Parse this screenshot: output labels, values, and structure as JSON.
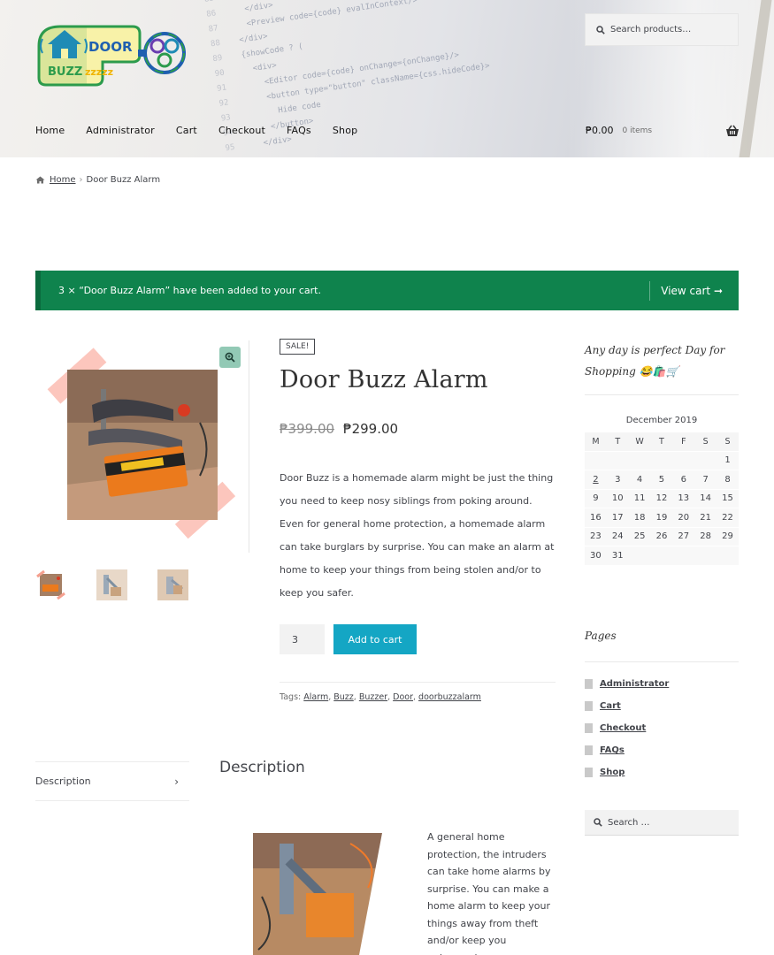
{
  "logo": {
    "line1": "DOOR",
    "line2": "BUZZzzzzz"
  },
  "search": {
    "placeholder": "Search products…"
  },
  "nav": [
    "Home",
    "Administrator",
    "Cart",
    "Checkout",
    "FAQs",
    "Shop"
  ],
  "cart": {
    "total": "₱0.00",
    "items": "0 items"
  },
  "breadcrumb": {
    "home": "Home",
    "current": "Door Buzz Alarm"
  },
  "notice": {
    "message": "3 × “Door Buzz Alarm” have been added to your cart.",
    "view_cart": "View cart ➞"
  },
  "product": {
    "badge": "SALE!",
    "title": "Door Buzz Alarm",
    "price_old": "₱399.00",
    "price_new": "₱299.00",
    "description": "Door Buzz is a homemade alarm might be just the thing you need to keep nosy siblings from poking around. Even for general home protection, a homemade alarm can take burglars by surprise. You can make an alarm at home to keep your things from being stolen and/or to keep you safer.",
    "quantity": "3",
    "add_to_cart": "Add to cart",
    "tags_label": "Tags:",
    "tags": [
      "Alarm",
      "Buzz",
      "Buzzer",
      "Door",
      "doorbuzzalarm"
    ]
  },
  "sidebar": {
    "tagline": "Any day is perfect Day for Shopping 😂🛍️🛒",
    "calendar": {
      "caption": "December 2019",
      "days": [
        "M",
        "T",
        "W",
        "T",
        "F",
        "S",
        "S"
      ],
      "weeks": [
        [
          "",
          "",
          "",
          "",
          "",
          "",
          "1"
        ],
        [
          "2",
          "3",
          "4",
          "5",
          "6",
          "7",
          "8"
        ],
        [
          "9",
          "10",
          "11",
          "12",
          "13",
          "14",
          "15"
        ],
        [
          "16",
          "17",
          "18",
          "19",
          "20",
          "21",
          "22"
        ],
        [
          "23",
          "24",
          "25",
          "26",
          "27",
          "28",
          "29"
        ],
        [
          "30",
          "31",
          "",
          "",
          "",
          "",
          ""
        ]
      ]
    },
    "pages_title": "Pages",
    "pages": [
      "Administrator",
      "Cart",
      "Checkout",
      "FAQs",
      "Shop"
    ],
    "search_placeholder": "Search …"
  },
  "tabs": {
    "description_tab": "Description",
    "description_heading": "Description"
  },
  "description_text": "A general home protection, the intruders can take home alarms by surprise. You can make a home alarm to keep your things away from theft and/or keep you unharmed.",
  "colors": {
    "notice_green": "#0f834d",
    "button_blue": "#14a6c4",
    "zoom_teal": "#92c9b5"
  }
}
